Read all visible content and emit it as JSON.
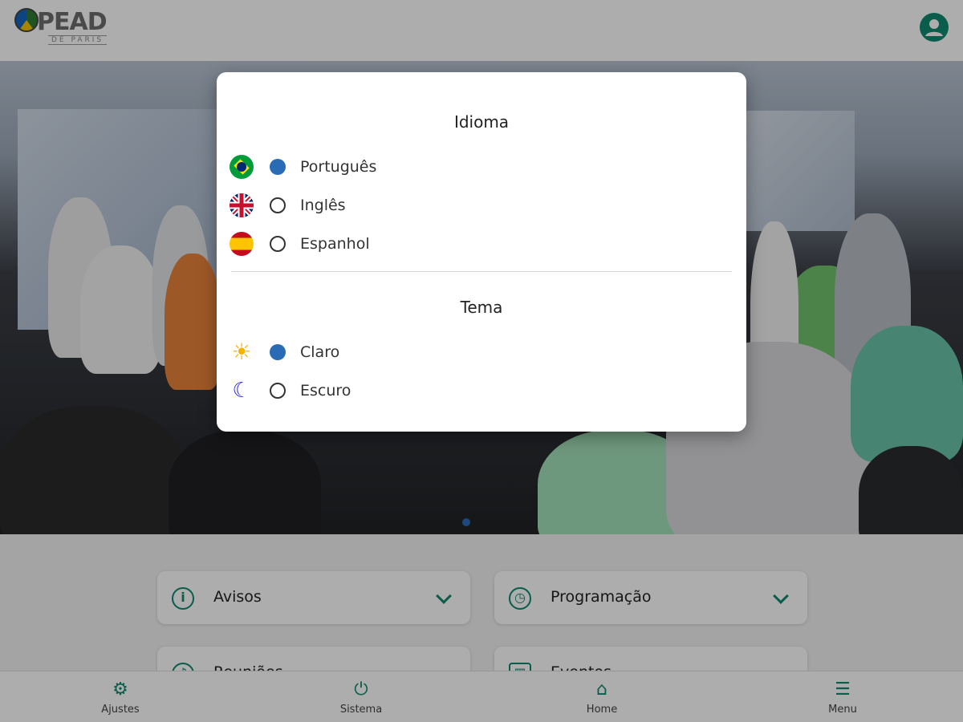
{
  "header": {
    "logo_text": "PEAD",
    "logo_sub": "DE PARIS"
  },
  "cards": [
    {
      "label": "Avisos",
      "icon": "info-icon"
    },
    {
      "label": "Programação",
      "icon": "clock-icon"
    },
    {
      "label": "Reuniões",
      "icon": "music-icon"
    },
    {
      "label": "Eventos",
      "icon": "calendar-icon"
    }
  ],
  "dialog": {
    "language_title": "Idioma",
    "languages": [
      {
        "label": "Português",
        "flag": "brazil-flag-icon",
        "selected": true
      },
      {
        "label": "Inglês",
        "flag": "uk-flag-icon",
        "selected": false
      },
      {
        "label": "Espanhol",
        "flag": "spain-flag-icon",
        "selected": false
      }
    ],
    "theme_title": "Tema",
    "themes": [
      {
        "label": "Claro",
        "icon": "sun-icon",
        "selected": true
      },
      {
        "label": "Escuro",
        "icon": "moon-icon",
        "selected": false
      }
    ]
  },
  "bottom_nav": [
    {
      "label": "Ajustes",
      "icon": "gear-icon"
    },
    {
      "label": "Sistema",
      "icon": "power-icon"
    },
    {
      "label": "Home",
      "icon": "home-icon"
    },
    {
      "label": "Menu",
      "icon": "menu-icon"
    }
  ],
  "colors": {
    "accent": "#0e8a6e",
    "radio_selected": "#2a6bb5"
  }
}
